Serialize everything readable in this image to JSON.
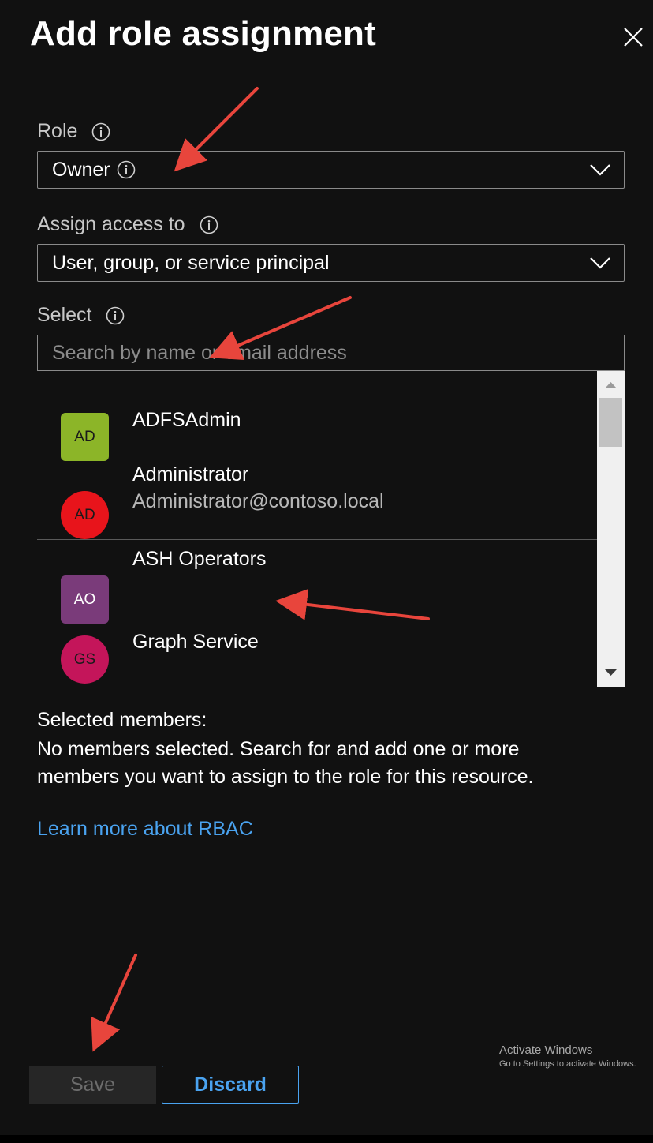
{
  "panel": {
    "title": "Add role assignment",
    "close_icon": "close-icon"
  },
  "role": {
    "label": "Role",
    "value": "Owner"
  },
  "assign_access": {
    "label": "Assign access to",
    "value": "User, group, or service principal"
  },
  "select": {
    "label": "Select",
    "placeholder": "Search by name or email address"
  },
  "members": [
    {
      "initials": "AD",
      "name": "ADFSAdmin",
      "email": "",
      "color": "#8cb528",
      "shape": "square"
    },
    {
      "initials": "AD",
      "name": "Administrator",
      "email": "Administrator@contoso.local",
      "color": "#e8141b",
      "shape": "circle"
    },
    {
      "initials": "AO",
      "name": "ASH Operators",
      "email": "",
      "color": "#7a3b7a",
      "shape": "square"
    },
    {
      "initials": "GS",
      "name": "Graph Service",
      "email": "",
      "color": "#c4155a",
      "shape": "circle"
    }
  ],
  "selected": {
    "title": "Selected members:",
    "description": "No members selected. Search for and add one or more members you want to assign to the role for this resource."
  },
  "learn_more": "Learn more about RBAC",
  "buttons": {
    "save": "Save",
    "discard": "Discard"
  },
  "watermark": {
    "title": "Activate Windows",
    "subtitle": "Go to Settings to activate Windows."
  },
  "colors": {
    "background": "#111111",
    "accent": "#4aa3f0",
    "annotation_arrow": "#e8453c"
  }
}
